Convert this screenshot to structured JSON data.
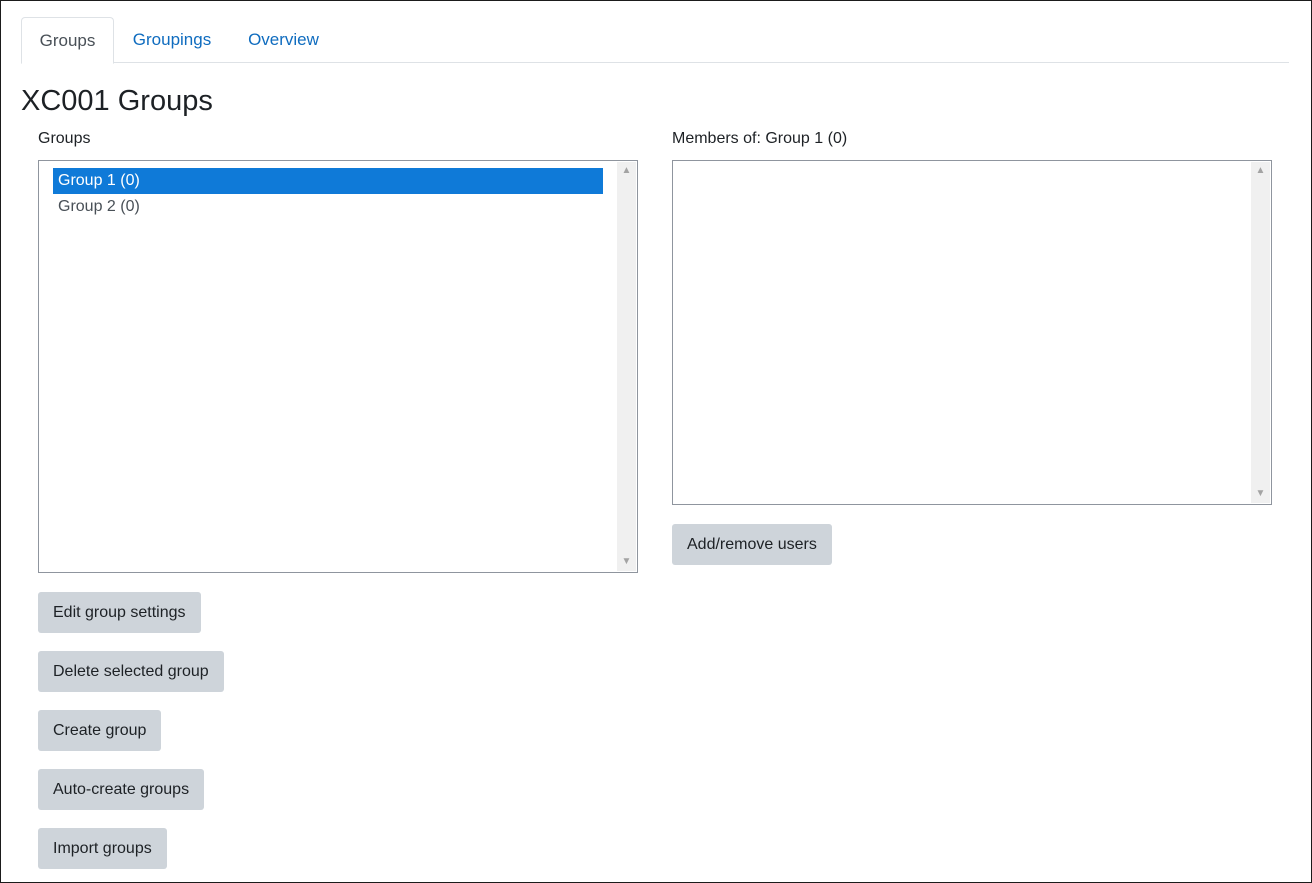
{
  "tabs": [
    {
      "label": "Groups",
      "active": true
    },
    {
      "label": "Groupings",
      "active": false
    },
    {
      "label": "Overview",
      "active": false
    }
  ],
  "page_title": "XC001 Groups",
  "groups_panel": {
    "label": "Groups",
    "options": [
      {
        "label": "Group 1 (0)",
        "selected": true
      },
      {
        "label": "Group 2 (0)",
        "selected": false
      }
    ],
    "buttons": {
      "edit": "Edit group settings",
      "delete": "Delete selected group",
      "create": "Create group",
      "auto_create": "Auto-create groups",
      "import": "Import groups"
    }
  },
  "members_panel": {
    "label": "Members of: Group 1 (0)",
    "options": [],
    "button": "Add/remove users"
  },
  "colors": {
    "accent": "#0f6cbf",
    "selected": "#0f7ad8",
    "button_bg": "#ced4da"
  }
}
